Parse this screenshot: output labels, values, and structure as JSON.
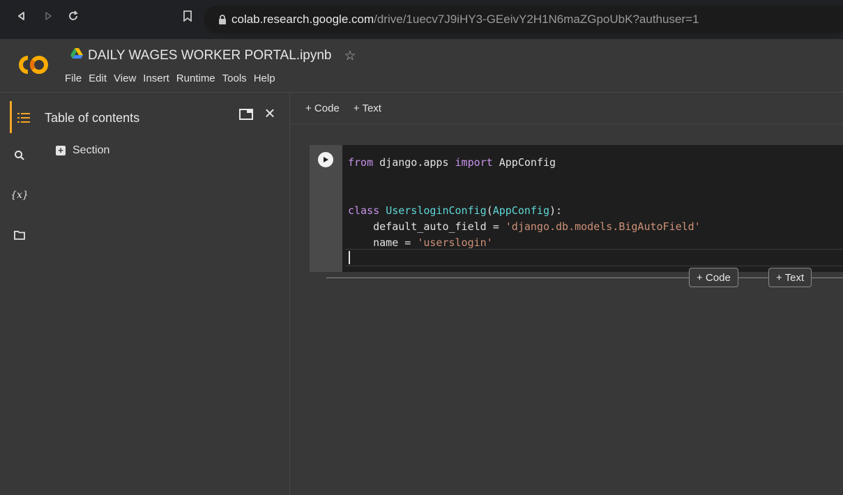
{
  "browser": {
    "url_host": "colab.research.google.com",
    "url_path": "/drive/1uecv7J9iHY3-GEeivY2H1N6maZGpoUbK?authuser=1"
  },
  "notebook": {
    "title": "DAILY WAGES WORKER PORTAL.ipynb",
    "menu": [
      "File",
      "Edit",
      "View",
      "Insert",
      "Runtime",
      "Tools",
      "Help"
    ]
  },
  "toc": {
    "title": "Table of contents",
    "section_label": "Section"
  },
  "toolbar": {
    "add_code": "+ Code",
    "add_text": "+ Text"
  },
  "cell": {
    "lines": [
      {
        "tokens": [
          {
            "t": "kw",
            "v": "from"
          },
          {
            "t": "plain",
            "v": " django.apps "
          },
          {
            "t": "kw",
            "v": "import"
          },
          {
            "t": "plain",
            "v": " AppConfig"
          }
        ]
      },
      {
        "tokens": []
      },
      {
        "tokens": []
      },
      {
        "tokens": [
          {
            "t": "kw",
            "v": "class"
          },
          {
            "t": "plain",
            "v": " "
          },
          {
            "t": "cls",
            "v": "UsersloginConfig"
          },
          {
            "t": "plain",
            "v": "("
          },
          {
            "t": "cls",
            "v": "AppConfig"
          },
          {
            "t": "plain",
            "v": "):"
          }
        ]
      },
      {
        "tokens": [
          {
            "t": "plain",
            "v": "    default_auto_field = "
          },
          {
            "t": "str",
            "v": "'django.db.models.BigAutoField'"
          }
        ]
      },
      {
        "tokens": [
          {
            "t": "plain",
            "v": "    name = "
          },
          {
            "t": "str",
            "v": "'userslogin'"
          }
        ]
      }
    ]
  },
  "between_cells": {
    "add_code": "+ Code",
    "add_text": "+ Text"
  },
  "colors": {
    "accent": "#f5a623",
    "keyword": "#c792ea",
    "class": "#5fd7d7",
    "string": "#ce9178"
  }
}
